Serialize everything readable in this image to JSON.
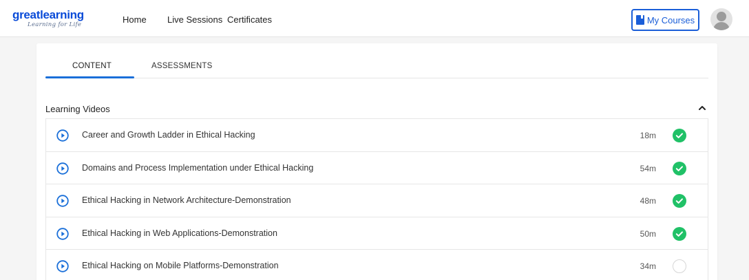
{
  "header": {
    "logo_main": "greatlearning",
    "logo_sub": "Learning for Life",
    "nav": [
      "Home",
      "Live Sessions",
      "Certificates"
    ],
    "my_courses_label": "My Courses",
    "brand_color": "#1a5ed8"
  },
  "tabs": [
    {
      "label": "CONTENT",
      "active": true
    },
    {
      "label": "ASSESSMENTS",
      "active": false
    }
  ],
  "section": {
    "title": "Learning Videos",
    "expanded": true
  },
  "videos": [
    {
      "title": "Career and Growth Ladder in Ethical Hacking",
      "duration": "18m",
      "completed": true
    },
    {
      "title": "Domains and Process Implementation under Ethical Hacking",
      "duration": "54m",
      "completed": true
    },
    {
      "title": "Ethical Hacking in Network Architecture-Demonstration",
      "duration": "48m",
      "completed": true
    },
    {
      "title": "Ethical Hacking in Web Applications-Demonstration",
      "duration": "50m",
      "completed": true
    },
    {
      "title": "Ethical Hacking on Mobile Platforms-Demonstration",
      "duration": "34m",
      "completed": false
    }
  ],
  "colors": {
    "complete": "#20c167",
    "play": "#1a6fd9",
    "tab_active": "#1a6fd9"
  }
}
